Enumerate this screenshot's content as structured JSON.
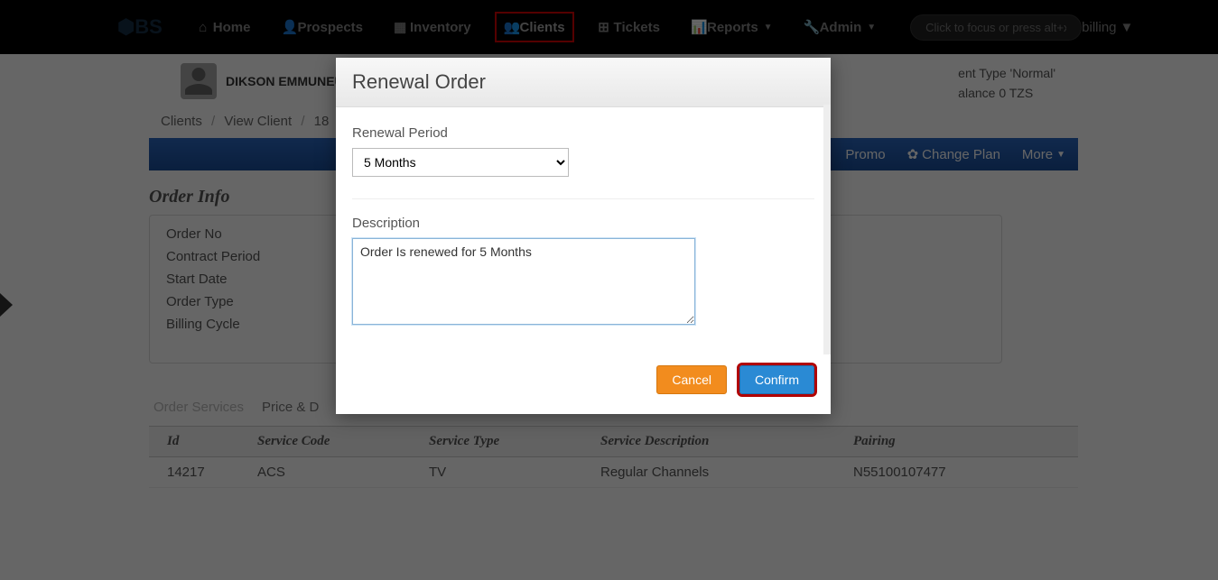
{
  "navbar": {
    "logo": "⬢BS",
    "items": [
      {
        "label": "Home",
        "icon": "⌂"
      },
      {
        "label": "Prospects",
        "icon": "👤"
      },
      {
        "label": "Inventory",
        "icon": "▦"
      },
      {
        "label": "Clients",
        "icon": "👥",
        "highlighted": true
      },
      {
        "label": "Tickets",
        "icon": "⊞"
      },
      {
        "label": "Reports",
        "icon": "📊",
        "caret": true
      },
      {
        "label": "Admin",
        "icon": "🔧",
        "caret": true
      }
    ],
    "search_placeholder": "Click to focus or press alt+x",
    "user": "billing"
  },
  "client": {
    "name": "DIKSON EMMUNEUL",
    "meta_type_label": "ent Type",
    "meta_type_value": "Normal",
    "meta_balance_label": "alance",
    "meta_balance_value": "0 TZS"
  },
  "breadcrumb": {
    "a": "Clients",
    "b": "View Client",
    "c": "18"
  },
  "bluebar": {
    "promo": "Promo",
    "change_plan": "Change Plan",
    "more": "More"
  },
  "order_info": {
    "title": "Order Info",
    "rows": [
      "Order No",
      "Contract Period",
      "Start Date",
      "Order Type",
      "Billing Cycle"
    ]
  },
  "tabs": {
    "services": "Order Services",
    "price": "Price & D"
  },
  "table": {
    "headers": {
      "id": "Id",
      "code": "Service Code",
      "type": "Service Type",
      "desc": "Service Description",
      "pair": "Pairing"
    },
    "row": {
      "id": "14217",
      "code": "ACS",
      "type": "TV",
      "desc": "Regular Channels",
      "pair": "N55100107477"
    }
  },
  "modal": {
    "title": "Renewal Order",
    "period_label": "Renewal Period",
    "period_value": "5 Months",
    "desc_label": "Description",
    "desc_value": "Order Is renewed for 5 Months",
    "cancel": "Cancel",
    "confirm": "Confirm"
  }
}
